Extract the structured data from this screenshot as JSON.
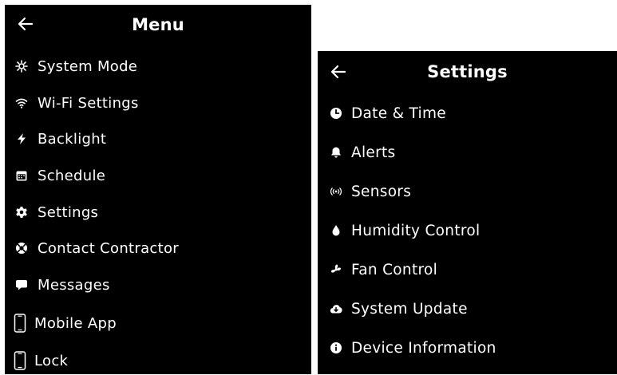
{
  "menu": {
    "title": "Menu",
    "back_icon": "arrow-left-icon",
    "items": [
      {
        "label": "System Mode",
        "icon": "system-mode-icon"
      },
      {
        "label": "Wi-Fi Settings",
        "icon": "wifi-icon"
      },
      {
        "label": "Backlight",
        "icon": "bolt-icon"
      },
      {
        "label": "Schedule",
        "icon": "calendar-icon"
      },
      {
        "label": "Settings",
        "icon": "gear-icon"
      },
      {
        "label": "Contact Contractor",
        "icon": "lifebuoy-icon"
      },
      {
        "label": "Messages",
        "icon": "message-icon"
      },
      {
        "label": "Mobile App",
        "icon": "phone-icon"
      },
      {
        "label": "Lock",
        "icon": "phone-icon"
      }
    ]
  },
  "settings": {
    "title": "Settings",
    "back_icon": "arrow-left-icon",
    "items": [
      {
        "label": "Date & Time",
        "icon": "clock-icon"
      },
      {
        "label": "Alerts",
        "icon": "bell-icon"
      },
      {
        "label": "Sensors",
        "icon": "sensor-broadcast-icon"
      },
      {
        "label": "Humidity Control",
        "icon": "droplet-icon"
      },
      {
        "label": "Fan Control",
        "icon": "fan-icon"
      },
      {
        "label": "System Update",
        "icon": "cloud-download-icon"
      },
      {
        "label": "Device Information",
        "icon": "info-icon"
      }
    ]
  },
  "colors": {
    "panel_bg": "#000000",
    "text": "#ffffff",
    "page_bg": "#ffffff"
  }
}
